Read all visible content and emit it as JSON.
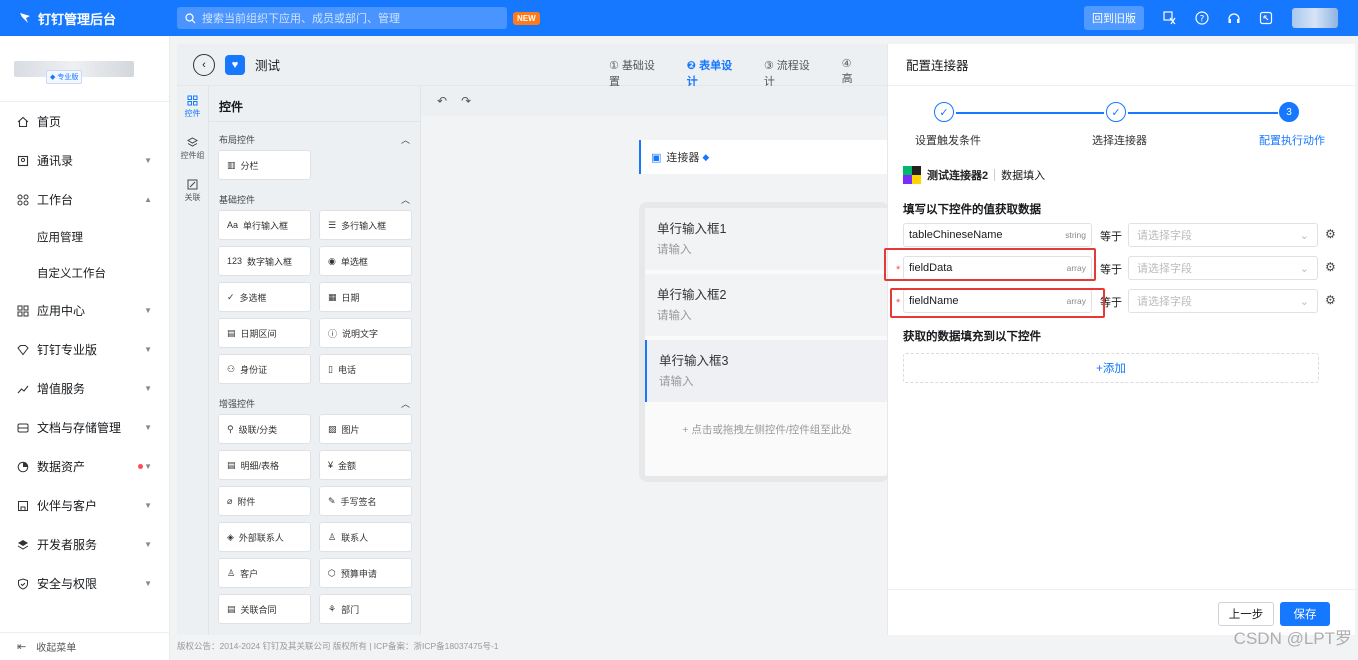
{
  "topbar": {
    "brand": "钉钉管理后台",
    "search_placeholder": "搜索当前组织下应用、成员或部门、管理",
    "new_badge": "NEW",
    "old_version": "回到旧版",
    "icons": [
      "translate-icon",
      "help-icon",
      "headset-icon",
      "fullscreen-icon"
    ]
  },
  "leftnav": {
    "pro_tag": "专业版",
    "items": [
      {
        "label": "首页",
        "icon": "home-icon"
      },
      {
        "label": "通讯录",
        "icon": "contacts-icon"
      },
      {
        "label": "工作台",
        "icon": "workbench-icon"
      },
      {
        "label": "应用管理",
        "sub": true
      },
      {
        "label": "自定义工作台",
        "sub": true
      },
      {
        "label": "应用中心",
        "icon": "apps-icon"
      },
      {
        "label": "钉钉专业版",
        "icon": "diamond-icon"
      },
      {
        "label": "增值服务",
        "icon": "chart-icon"
      },
      {
        "label": "文档与存储管理",
        "icon": "storage-icon"
      },
      {
        "label": "数据资产",
        "icon": "data-icon"
      },
      {
        "label": "伙伴与客户",
        "icon": "partner-icon"
      },
      {
        "label": "开发者服务",
        "icon": "layers-icon"
      },
      {
        "label": "安全与权限",
        "icon": "shield-icon"
      }
    ],
    "collapse": "收起菜单"
  },
  "editor": {
    "title": "测试",
    "steps": [
      "① 基础设置",
      "❷ 表单设计",
      "③ 流程设计",
      "④ 高"
    ],
    "rail": [
      "控件",
      "控件组",
      "关联"
    ],
    "widgets_title": "控件",
    "groups": [
      {
        "title": "布局控件",
        "items": [
          "分栏"
        ]
      },
      {
        "title": "基础控件",
        "items": [
          "单行输入框",
          "多行输入框",
          "数字输入框",
          "单选框",
          "多选框",
          "日期",
          "日期区间",
          "说明文字",
          "身份证",
          "电话"
        ]
      },
      {
        "title": "增强控件",
        "items": [
          "级联/分类",
          "图片",
          "明细/表格",
          "金额",
          "附件",
          "手写签名",
          "外部联系人",
          "联系人",
          "客户",
          "预算申请",
          "关联合同",
          "部门"
        ]
      }
    ],
    "connector_label": "连接器",
    "fields": [
      {
        "label": "单行输入框1",
        "placeholder": "请输入"
      },
      {
        "label": "单行输入框2",
        "placeholder": "请输入"
      },
      {
        "label": "单行输入框3",
        "placeholder": "请输入"
      }
    ],
    "drop_hint": "+ 点击或拖拽左侧控件/控件组至此处"
  },
  "drawer": {
    "title": "配置连接器",
    "steps": [
      {
        "label": "设置触发条件"
      },
      {
        "label": "选择连接器"
      },
      {
        "label": "配置执行动作",
        "num": "3"
      }
    ],
    "connector_name": "测试连接器2",
    "action_name": "数据填入",
    "section1": "填写以下控件的值获取数据",
    "rows": [
      {
        "field": "tableChineseName",
        "type": "string",
        "required": false,
        "eq": "等于",
        "placeholder": "请选择字段"
      },
      {
        "field": "fieldData",
        "type": "array",
        "required": true,
        "eq": "等于",
        "placeholder": "请选择字段"
      },
      {
        "field": "fieldName",
        "type": "array",
        "required": true,
        "eq": "等于",
        "placeholder": "请选择字段"
      }
    ],
    "section2": "获取的数据填充到以下控件",
    "add_label": "+添加",
    "prev": "上一步",
    "save": "保存"
  },
  "footer": "版权公告：2014-2024 钉钉及其关联公司 版权所有 | ICP备案：浙ICP备18037475号-1",
  "watermark": "CSDN @LPT罗",
  "colors": {
    "primary": "#1677ff",
    "danger": "#e53935",
    "badge": "#ff7a1a"
  }
}
